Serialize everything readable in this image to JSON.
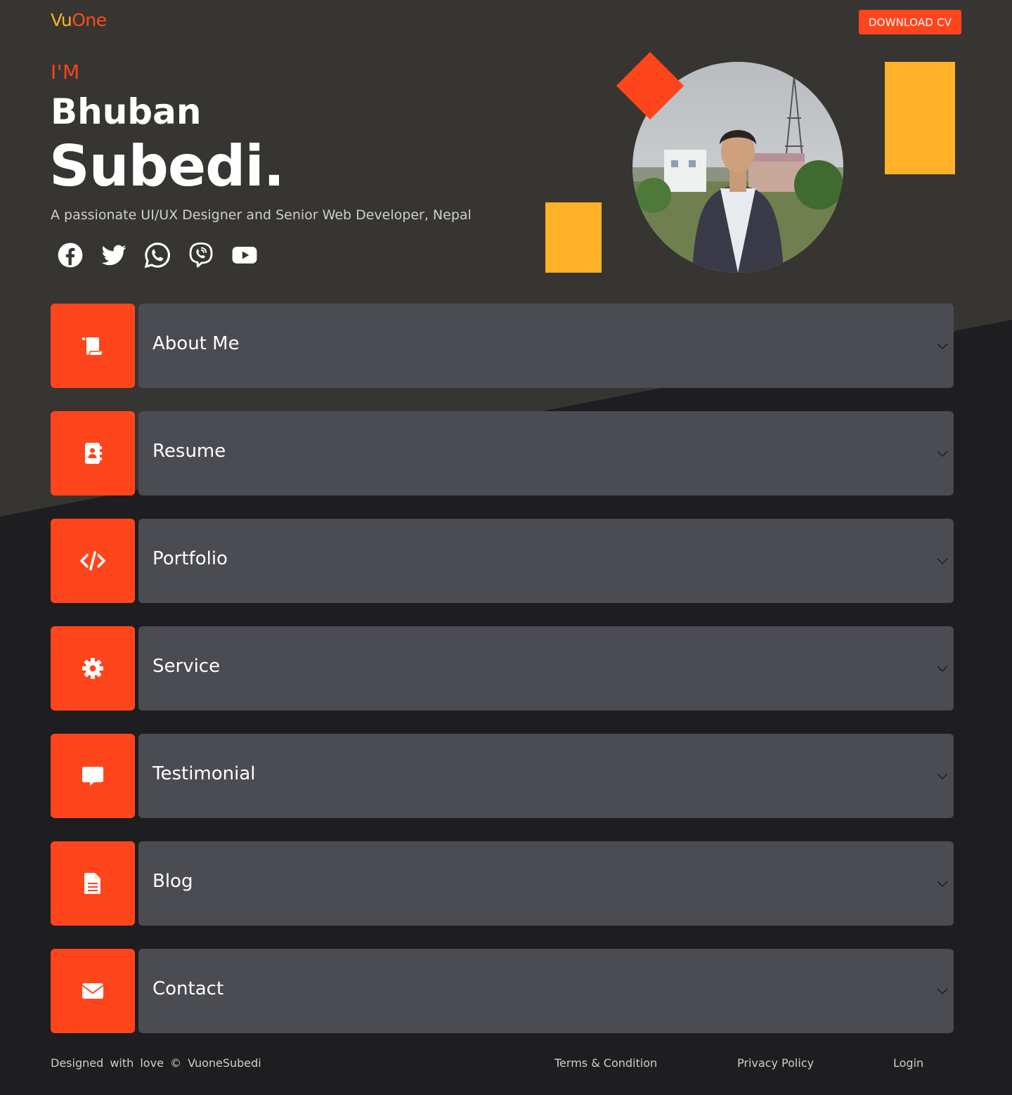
{
  "colors": {
    "accent": "#ff451c",
    "accent_yellow": "#ffb128",
    "background_dark": "#1e1d1f",
    "background_top": "#373531",
    "panel": "#4b4c52"
  },
  "header": {
    "logo_part1": "Vu",
    "logo_part2": "One",
    "download_button": "DOWNLOAD CV"
  },
  "hero": {
    "intro": "I'M",
    "first_name": "Bhuban",
    "last_name": "Subedi.",
    "tagline": "A passionate UI/UX Designer and Senior Web Developer, Nepal",
    "socials": [
      {
        "name": "facebook",
        "icon": "facebook-icon"
      },
      {
        "name": "twitter",
        "icon": "twitter-icon"
      },
      {
        "name": "whatsapp",
        "icon": "whatsapp-icon"
      },
      {
        "name": "viber",
        "icon": "viber-icon"
      },
      {
        "name": "youtube",
        "icon": "youtube-icon"
      }
    ]
  },
  "sections": [
    {
      "label": "About Me",
      "icon": "scroll-icon"
    },
    {
      "label": "Resume",
      "icon": "address-book-icon"
    },
    {
      "label": "Portfolio",
      "icon": "code-icon"
    },
    {
      "label": "Service",
      "icon": "gear-icon"
    },
    {
      "label": "Testimonial",
      "icon": "comment-icon"
    },
    {
      "label": "Blog",
      "icon": "document-icon"
    },
    {
      "label": "Contact",
      "icon": "envelope-icon"
    }
  ],
  "footer": {
    "credit": "Designed with love © VuoneSubedi",
    "links": [
      "Terms & Condition",
      "Privacy Policy",
      "Login"
    ]
  }
}
